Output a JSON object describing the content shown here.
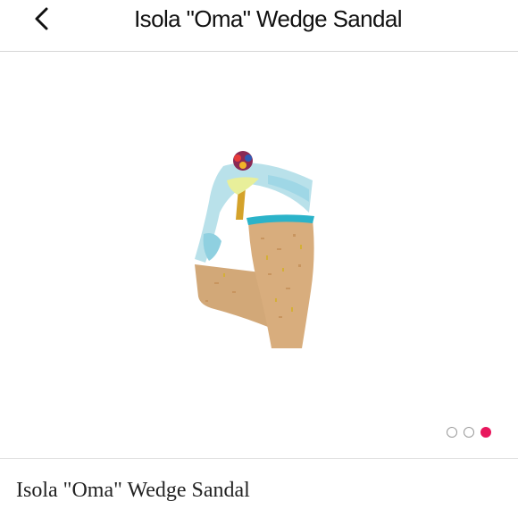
{
  "header": {
    "back_icon": "chevron-left-icon",
    "title": "Isola \"Oma\" Wedge Sandal"
  },
  "gallery": {
    "image_subject": "wedge-sandal-back-view",
    "total_images": 3,
    "active_index": 2,
    "active_dot_color": "#e8175d"
  },
  "product": {
    "name": "Isola \"Oma\" Wedge Sandal"
  }
}
